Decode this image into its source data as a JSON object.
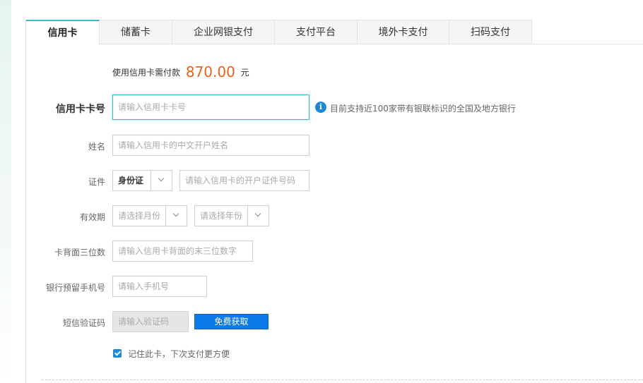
{
  "tabs": [
    {
      "label": "信用卡",
      "active": true
    },
    {
      "label": "储蓄卡"
    },
    {
      "label": "企业网银支付"
    },
    {
      "label": "支付平台"
    },
    {
      "label": "境外卡支付"
    },
    {
      "label": "扫码支付"
    }
  ],
  "payment": {
    "prefix": "使用信用卡需付款",
    "amount": "870.00",
    "unit": "元"
  },
  "form": {
    "card_number": {
      "label": "信用卡卡号",
      "placeholder": "请输入信用卡卡号",
      "value": ""
    },
    "info_text": "目前支持近100家带有银联标识的全国及地方银行",
    "name": {
      "label": "姓名",
      "placeholder": "请输入信用卡的中文开户姓名",
      "value": ""
    },
    "id": {
      "label": "证件",
      "type_selected": "身份证",
      "placeholder": "请输入信用卡的开户证件号码",
      "value": ""
    },
    "expiry": {
      "label": "有效期",
      "month_placeholder": "请选择月份",
      "year_placeholder": "请选择年份"
    },
    "cvv": {
      "label": "卡背面三位数",
      "placeholder": "请输入信用卡背面的末三位数字",
      "value": ""
    },
    "phone": {
      "label": "银行预留手机号",
      "placeholder": "请输入手机号",
      "value": ""
    },
    "sms": {
      "label": "短信验证码",
      "placeholder": "请输入验证码",
      "value": "",
      "button_label": "免费获取"
    },
    "remember": {
      "label": "记住此卡，下次支付更方便",
      "checked": true
    }
  },
  "colors": {
    "accent": "#3fb8c6",
    "amount": "#e8621a",
    "primary_button": "#0c7ae8",
    "info_icon": "#1e88d6"
  },
  "icons": {
    "info": "info-icon",
    "dropdown": "chevron-down-icon",
    "checkbox": "checkbox-checked-icon"
  }
}
